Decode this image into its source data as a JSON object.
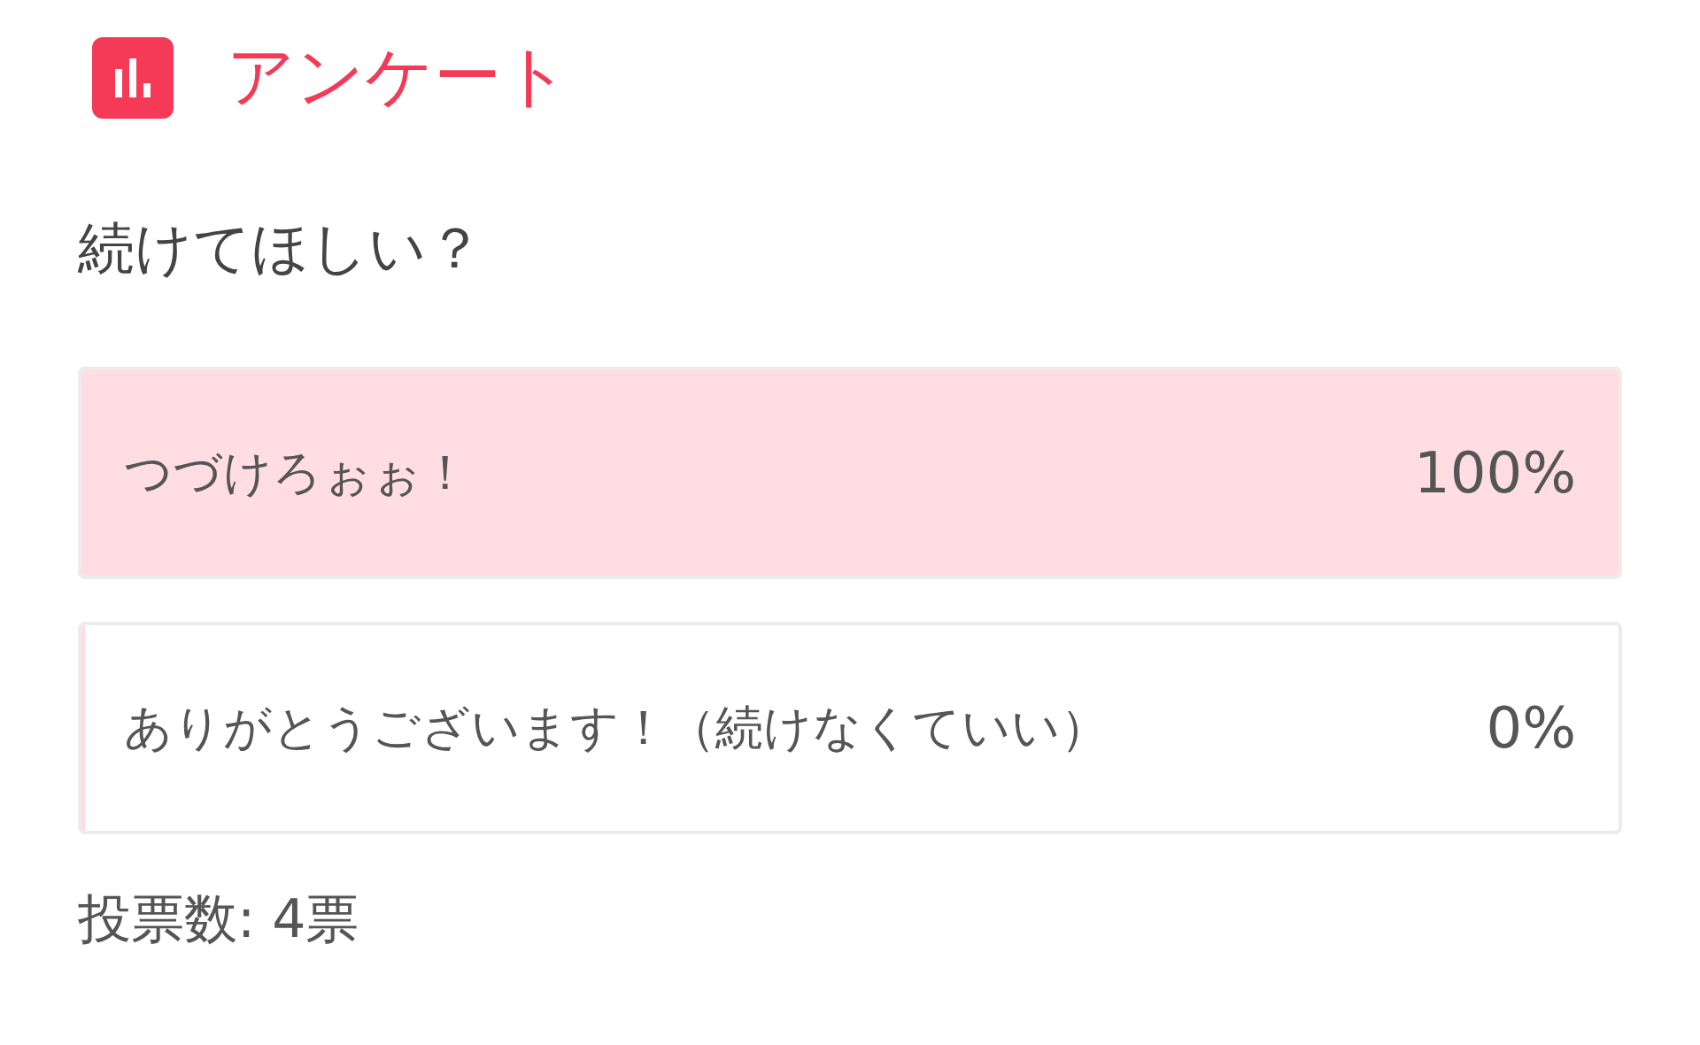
{
  "header": {
    "title": "アンケート"
  },
  "question": "続けてほしい？",
  "options": [
    {
      "label": "つづけろぉぉ！",
      "level": 1,
      "percent": "100%"
    },
    {
      "label": "ありがとうございます！（続けなくていい）",
      "level": 0,
      "percent": "0%"
    }
  ],
  "vote_count": "投票数: 4票"
}
